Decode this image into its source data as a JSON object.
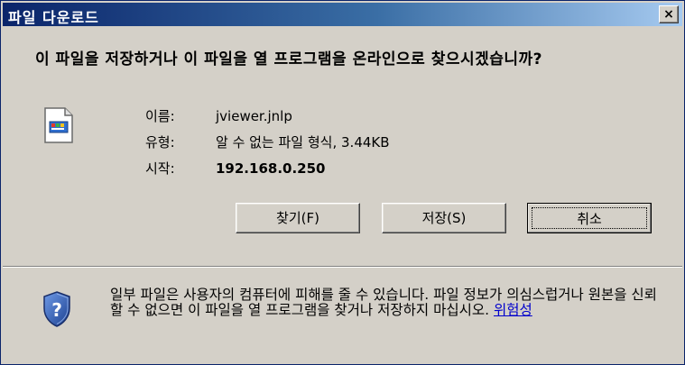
{
  "window": {
    "title": "파일 다운로드",
    "close_label": "×"
  },
  "dialog": {
    "question": "이 파일을 저장하거나 이 파일을 열 프로그램을 온라인으로 찾으시겠습니까?",
    "info": {
      "name_label": "이름:",
      "name_value": "jviewer.jnlp",
      "type_label": "유형:",
      "type_value": "알 수 없는 파일 형식, 3.44KB",
      "from_label": "시작:",
      "from_value": "192.168.0.250"
    },
    "buttons": {
      "find": "찾기(F)",
      "save": "저장(S)",
      "cancel": "취소"
    },
    "warning": {
      "text": "일부 파일은 사용자의 컴퓨터에 피해를 줄 수 있습니다. 파일 정보가 의심스럽거나 원본을 신뢰할 수 없으면 이 파일을 열 프로그램을 찾거나 저장하지 마십시오.",
      "link": "위험성"
    }
  },
  "icons": {
    "file": "file-icon",
    "shield": "shield-question-icon",
    "close": "close-icon"
  },
  "colors": {
    "titlebar_start": "#0a246a",
    "titlebar_end": "#a6caf0",
    "dialog_bg": "#d4d0c8",
    "link": "#0000cc",
    "shield": "#2c5fb5"
  }
}
